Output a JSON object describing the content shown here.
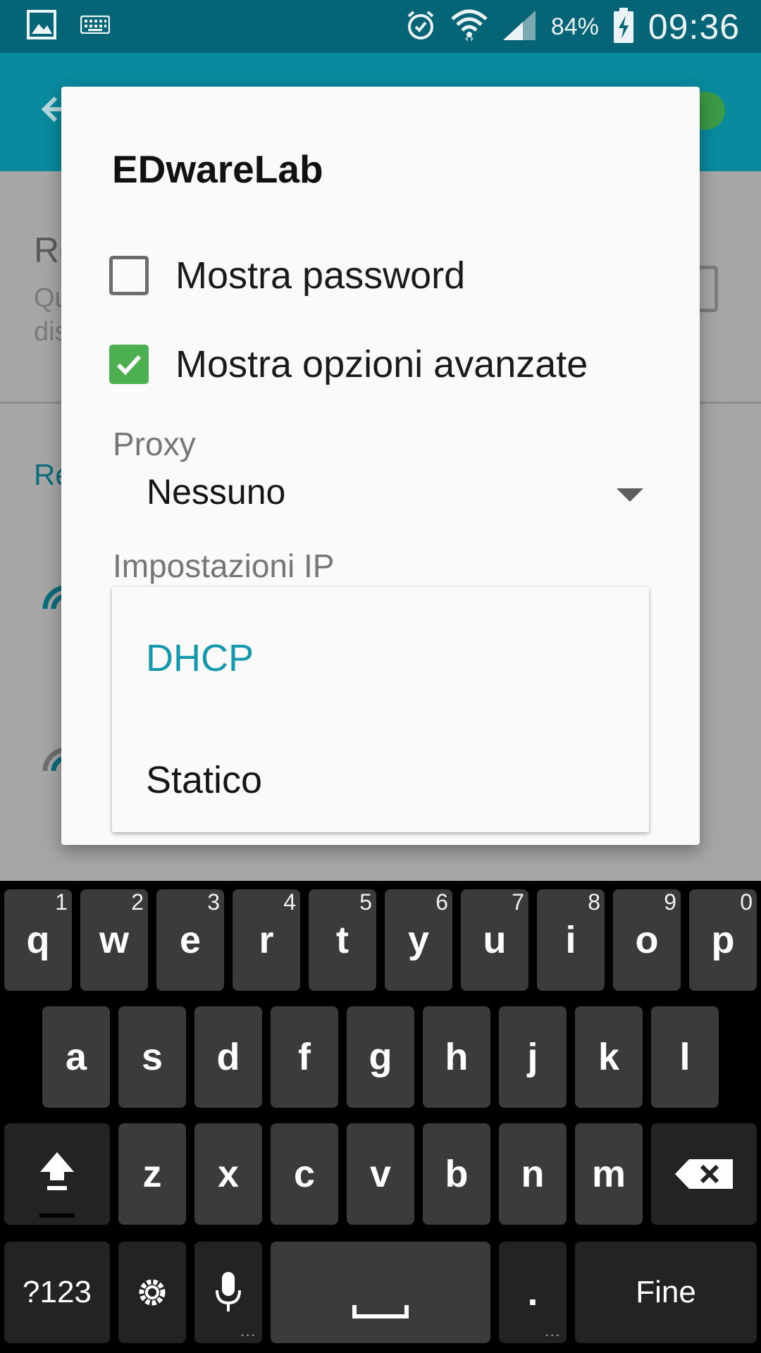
{
  "status_bar": {
    "battery_percent": "84%",
    "time": "09:36",
    "icons": [
      "gallery-icon",
      "keyboard-icon",
      "alarm-icon",
      "wifi-icon",
      "signal-icon",
      "battery-charging-icon"
    ]
  },
  "background": {
    "title_fragment": "Re",
    "subtitle_fragment_1": "Qu",
    "subtitle_fragment_2": "dis",
    "section_fragment": "Re"
  },
  "dialog": {
    "title": "EDwareLab",
    "show_password_label": "Mostra password",
    "show_password_checked": false,
    "show_advanced_label": "Mostra opzioni avanzate",
    "show_advanced_checked": true,
    "proxy_label": "Proxy",
    "proxy_value": "Nessuno",
    "ip_settings_label": "Impostazioni IP",
    "ip_options": [
      "DHCP",
      "Statico"
    ],
    "ip_selected": "DHCP"
  },
  "keyboard": {
    "row1": [
      {
        "key": "q",
        "hint": "1"
      },
      {
        "key": "w",
        "hint": "2"
      },
      {
        "key": "e",
        "hint": "3"
      },
      {
        "key": "r",
        "hint": "4"
      },
      {
        "key": "t",
        "hint": "5"
      },
      {
        "key": "y",
        "hint": "6"
      },
      {
        "key": "u",
        "hint": "7"
      },
      {
        "key": "i",
        "hint": "8"
      },
      {
        "key": "o",
        "hint": "9"
      },
      {
        "key": "p",
        "hint": "0"
      }
    ],
    "row2": [
      "a",
      "s",
      "d",
      "f",
      "g",
      "h",
      "j",
      "k",
      "l"
    ],
    "row3": [
      "z",
      "x",
      "c",
      "v",
      "b",
      "n",
      "m"
    ],
    "symbols_label": "?123",
    "period_label": ".",
    "done_label": "Fine",
    "accent_color": "#4caf50",
    "selected_color": "#1597ad"
  }
}
